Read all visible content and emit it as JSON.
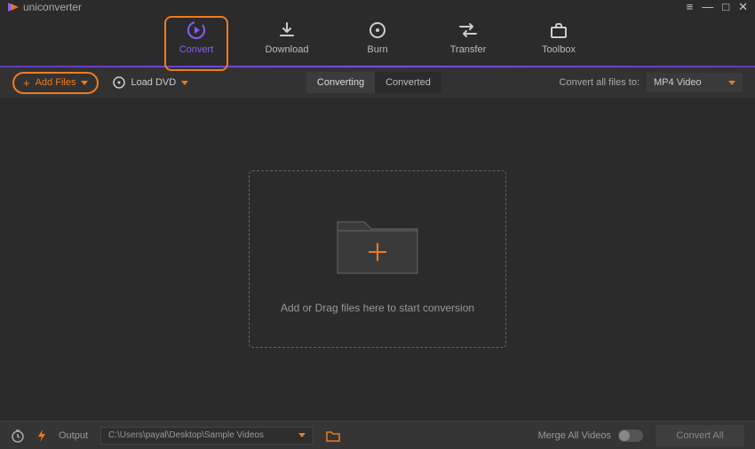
{
  "app": {
    "name": "uniconverter"
  },
  "nav": {
    "items": [
      {
        "label": "Convert"
      },
      {
        "label": "Download"
      },
      {
        "label": "Burn"
      },
      {
        "label": "Transfer"
      },
      {
        "label": "Toolbox"
      }
    ],
    "active_index": 0
  },
  "toolbar": {
    "add_files_label": "Add Files",
    "load_dvd_label": "Load DVD",
    "tabs": {
      "converting": "Converting",
      "converted": "Converted"
    },
    "active_tab": "converting",
    "convert_all_label": "Convert all files to:",
    "output_format": "MP4 Video"
  },
  "dropzone": {
    "text": "Add or Drag files here to start conversion"
  },
  "footer": {
    "output_label": "Output",
    "output_path": "C:\\Users\\payal\\Desktop\\Sample Videos",
    "merge_label": "Merge All Videos",
    "merge_on": false,
    "convert_all_button": "Convert All"
  },
  "colors": {
    "accent_orange": "#f07b1d",
    "accent_purple": "#8a5cf7"
  }
}
